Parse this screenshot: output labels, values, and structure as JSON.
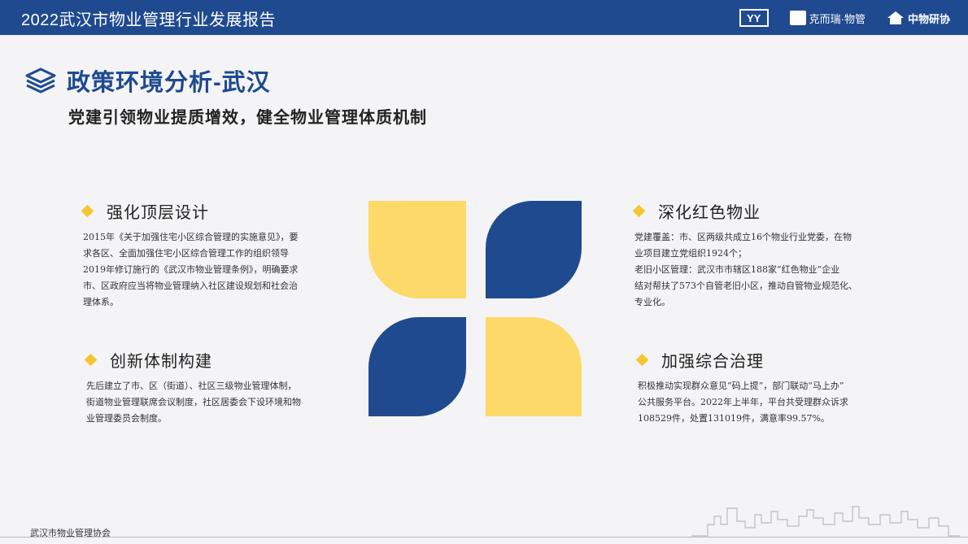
{
  "header": {
    "title": "2022武汉市物业管理行业发展报告",
    "logos": [
      {
        "name": "yy-logo",
        "text": "YY"
      },
      {
        "name": "keer-logo",
        "text": "克而瑞·物管"
      },
      {
        "name": "zhongwu-logo",
        "text": "中物研协"
      }
    ]
  },
  "page": {
    "heading": "政策环境分析-武汉",
    "subtitle": "党建引领物业提质增效，健全物业管理体质机制"
  },
  "sections": [
    {
      "label": "强化顶层设计",
      "lines": [
        "2015年《关于加强住宅小区综合管理的实施意见》，要",
        "求各区、全面加强住宅小区综合管理工作的组织领导",
        "2019年修订施行的《武汉市物业管理条例》，明确要求",
        "市、区政府应当将物业管理纳入社区建设规划和社会治",
        "理体系。"
      ]
    },
    {
      "label": "创新体制构建",
      "lines": [
        "先后建立了市、区（街道）、社区三级物业管理体制，",
        "街道物业管理联席会议制度，社区居委会下设环境和物",
        "业管理委员会制度。"
      ]
    },
    {
      "label": "深化红色物业",
      "lines": [
        "党建覆盖：市、区两级共成立16个物业行业党委，在物",
        "业项目建立党组织1924个；",
        "老旧小区管理：武汉市市辖区188家“红色物业”企业",
        "结对帮扶了573个自管老旧小区，推动自管物业规范化、",
        "专业化。"
      ]
    },
    {
      "label": "加强综合治理",
      "lines": [
        "积极推动实现群众意见“码上提”，部门联动“马上办”",
        "公共服务平台。2022年上半年，平台共受理群众诉求",
        "108529件，处置131019件，满意率99.57%。"
      ]
    }
  ],
  "footer": {
    "org": "武汉市物业管理协会"
  },
  "colors": {
    "brand_blue": "#1f4a8f",
    "accent_yellow": "#fdd969",
    "diamond": "#f6c632"
  }
}
